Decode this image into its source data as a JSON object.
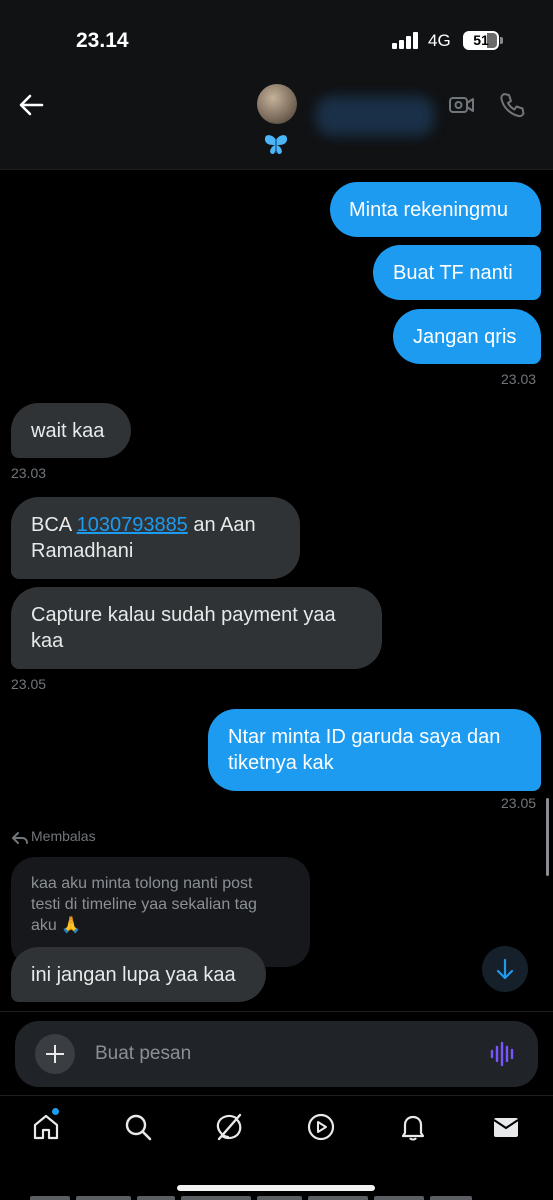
{
  "status_bar": {
    "time": "23.14",
    "network": "4G",
    "battery": "51"
  },
  "header": {
    "avatar_emoji": "🦋"
  },
  "messages": [
    {
      "id": "m1",
      "text": "Minta rekeningmu"
    },
    {
      "id": "m2",
      "text": "Buat TF nanti"
    },
    {
      "id": "m3",
      "text": "Jangan qris",
      "time": "23.03"
    },
    {
      "id": "m4",
      "text": "wait kaa",
      "time": "23.03"
    },
    {
      "id": "m5",
      "prefix": "BCA ",
      "link": "1030793885",
      "suffix": " an Aan",
      "line2": "Ramadhani"
    },
    {
      "id": "m6",
      "line1": "Capture kalau sudah payment yaa",
      "line2": "kaa",
      "time": "23.05"
    },
    {
      "id": "m7",
      "line1": "Ntar minta ID garuda saya dan",
      "line2": "tiketnya kak",
      "time": "23.05"
    }
  ],
  "reply": {
    "label": "Membalas",
    "quoted_line1": "kaa aku minta tolong nanti post",
    "quoted_line2": "testi di timeline yaa sekalian tag",
    "quoted_line3": "aku 🙏",
    "reply_text": "ini jangan lupa yaa kaa"
  },
  "composer": {
    "placeholder": "Buat pesan"
  },
  "nav": [
    "home-icon",
    "search-icon",
    "grok-icon",
    "video-icon",
    "notifications-icon",
    "messages-icon"
  ],
  "colors": {
    "accent": "#1d9bf0",
    "bubble_in": "#2f3336",
    "background": "#000000",
    "voice_icon": "#7856ff"
  }
}
